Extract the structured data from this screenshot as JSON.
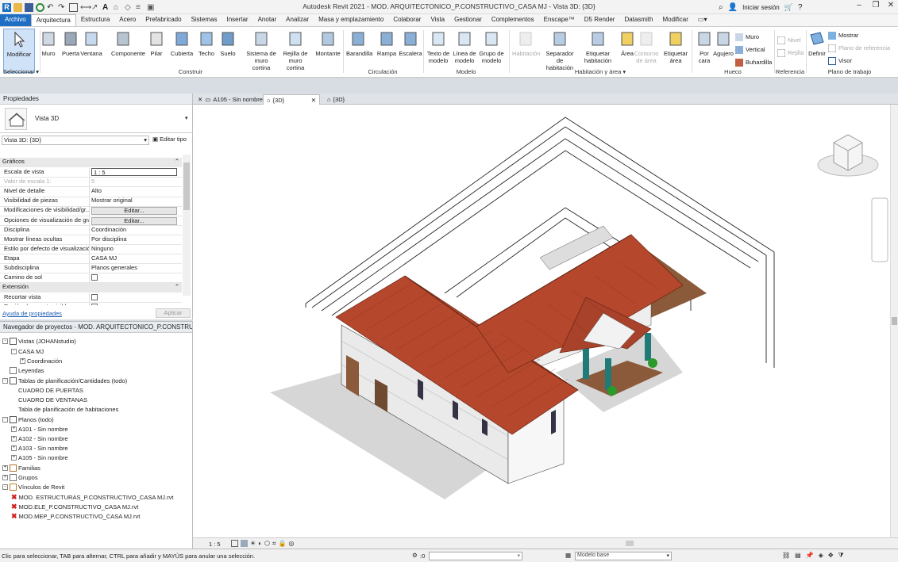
{
  "window": {
    "title": "Autodesk Revit 2021 - MOD. ARQUITECTONICO_P.CONSTRUCTIVO_CASA MJ - Vista 3D: {3D}",
    "sign_in": "Iniciar sesión",
    "help": "?"
  },
  "ribbon_tabs": [
    "Archivo",
    "Arquitectura",
    "Estructura",
    "Acero",
    "Prefabricado",
    "Sistemas",
    "Insertar",
    "Anotar",
    "Analizar",
    "Masa y emplazamiento",
    "Colaborar",
    "Vista",
    "Gestionar",
    "Complementos",
    "Enscape™",
    "D5 Render",
    "Datasmith",
    "Modificar"
  ],
  "ribbon": {
    "modify": "Modificar",
    "select_menu": "Seleccionar",
    "build": [
      "Muro",
      "Puerta",
      "Ventana",
      "Componente",
      "Pilar",
      "Cubierta",
      "Techo",
      "Suelo",
      "Sistema de muro cortina",
      "Rejilla de muro cortina",
      "Montante"
    ],
    "build_label": "Construir",
    "circulation": [
      "Barandilla",
      "Rampa",
      "Escalera"
    ],
    "circulation_label": "Circulación",
    "model": [
      "Texto de modelo",
      "Línea de modelo",
      "Grupo de modelo"
    ],
    "model_label": "Modelo",
    "room": [
      "Habitación",
      "Separador de habitación",
      "Etiquetar habitación",
      "Área",
      "Contorno de área",
      "Etiquetar área"
    ],
    "room_label": "Habitación y área",
    "opening": [
      "Por cara",
      "Agujero"
    ],
    "opening_small": [
      "Muro",
      "Vertical",
      "Buhardilla"
    ],
    "opening_label": "Hueco",
    "datum_small": [
      "Nivel",
      "Rejilla"
    ],
    "datum_label": "Referencia",
    "workplane_btn": "Definir",
    "workplane_small": [
      "Mostrar",
      "Plano de referencia",
      "Visor"
    ],
    "workplane_label": "Plano de trabajo"
  },
  "properties": {
    "header": "Propiedades",
    "type_name": "Vista 3D",
    "selector": "Vista 3D: {3D}",
    "edit_type": "Editar tipo",
    "group_graphics": "Gráficos",
    "rows": [
      {
        "k": "Escala de vista",
        "v": "1 : 5"
      },
      {
        "k": "Valor de escala    1:",
        "v": "5"
      },
      {
        "k": "Nivel de detalle",
        "v": "Alto"
      },
      {
        "k": "Visibilidad de piezas",
        "v": "Mostrar original"
      },
      {
        "k": "Modificaciones de visibilidad/gr...",
        "v": "Editar..."
      },
      {
        "k": "Opciones de visualización de grá...",
        "v": "Editar..."
      },
      {
        "k": "Disciplina",
        "v": "Coordinación"
      },
      {
        "k": "Mostrar líneas ocultas",
        "v": "Por disciplina"
      },
      {
        "k": "Estilo por defecto de visualizació...",
        "v": "Ninguno"
      },
      {
        "k": "Etapa",
        "v": "CASA MJ"
      },
      {
        "k": "Subdisciplina",
        "v": "Planos generales"
      },
      {
        "k": "Camino de sol",
        "v": ""
      }
    ],
    "group_extent": "Extensión",
    "extent_rows": [
      {
        "k": "Recortar vista",
        "v": ""
      },
      {
        "k": "Región de recorte visible",
        "v": ""
      }
    ],
    "help_link": "Ayuda de propiedades",
    "apply": "Aplicar"
  },
  "browser": {
    "header": "Navegador de proyectos - MOD. ARQUITECTONICO_P.CONSTRUCTIVO_...",
    "nodes": [
      {
        "t": "Vistas (JOHANstudio)",
        "lvl": 0,
        "tog": "-"
      },
      {
        "t": "CASA MJ",
        "lvl": 1,
        "tog": "-"
      },
      {
        "t": "Coordinación",
        "lvl": 2,
        "tog": "+"
      },
      {
        "t": "Leyendas",
        "lvl": 0,
        "tog": ""
      },
      {
        "t": "Tablas de planificación/Cantidades (todo)",
        "lvl": 0,
        "tog": "-"
      },
      {
        "t": "CUADRO DE PUERTAS",
        "lvl": 1,
        "tog": ""
      },
      {
        "t": "CUADRO DE VENTANAS",
        "lvl": 1,
        "tog": ""
      },
      {
        "t": "Tabla de planificación de habitaciones",
        "lvl": 1,
        "tog": ""
      },
      {
        "t": "Planos (todo)",
        "lvl": 0,
        "tog": "-"
      },
      {
        "t": "A101 - Sin nombre",
        "lvl": 1,
        "tog": "+"
      },
      {
        "t": "A102 - Sin nombre",
        "lvl": 1,
        "tog": "+"
      },
      {
        "t": "A103 - Sin nombre",
        "lvl": 1,
        "tog": "+"
      },
      {
        "t": "A105 - Sin nombre",
        "lvl": 1,
        "tog": "+"
      },
      {
        "t": "Familias",
        "lvl": 0,
        "tog": "+"
      },
      {
        "t": "Grupos",
        "lvl": 0,
        "tog": "+"
      },
      {
        "t": "Vínculos de Revit",
        "lvl": 0,
        "tog": "-"
      },
      {
        "t": "MOD. ESTRUCTURAS_P.CONSTRUCTIVO_CASA MJ.rvt",
        "lvl": 1,
        "tog": "x"
      },
      {
        "t": "MOD.ELE_P.CONSTRUCTIVO_CASA MJ.rvt",
        "lvl": 1,
        "tog": "x"
      },
      {
        "t": "MOD.MEP_P.CONSTRUCTIVO_CASA MJ.rvt",
        "lvl": 1,
        "tog": "x"
      }
    ]
  },
  "view_tabs": [
    "A105 - Sin nombre",
    "{3D}",
    "{3D}"
  ],
  "view_bar": {
    "scale": "1 : 5"
  },
  "status": {
    "hint": "Clic para seleccionar, TAB para alternar, CTRL para añadir y MAYÚS para anular una selección.",
    "zero": ":0",
    "model": "Modelo base"
  },
  "colors": {
    "accent": "#1e6fc4",
    "roof": "#b5472c",
    "teal": "#1f7a78"
  }
}
